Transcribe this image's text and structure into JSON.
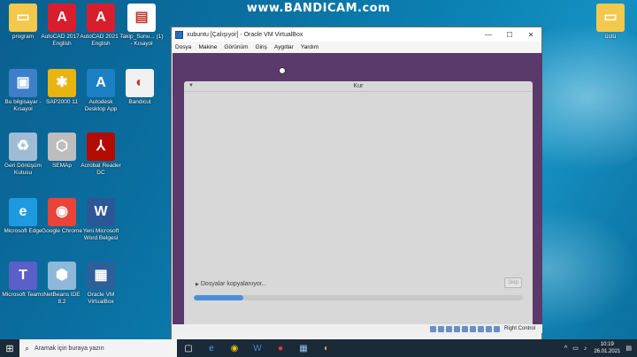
{
  "watermark": "www.BANDICAM.com",
  "desktop_icons": [
    {
      "label": "program",
      "color": "#f2c94c",
      "glyph": "▭"
    },
    {
      "label": "AutoCAD 2017 - English",
      "color": "#d81e2c",
      "glyph": "A"
    },
    {
      "label": "AutoCAD 2021 - English",
      "color": "#d81e2c",
      "glyph": "A"
    },
    {
      "label": "Takip_Sunu... (1) - Kısayol",
      "color": "#ffffff",
      "glyph": "▤"
    },
    {
      "label": "Bu bilgisayar - Kısayol",
      "color": "#3f7fc9",
      "glyph": "▣"
    },
    {
      "label": "SAP2000 11",
      "color": "#e8b40f",
      "glyph": "✱"
    },
    {
      "label": "Autodesk Desktop App",
      "color": "#1b7fc4",
      "glyph": "A"
    },
    {
      "label": "Bandicut",
      "color": "#f1f1f1",
      "glyph": "◐"
    },
    {
      "label": "Geri Dönüşüm Kutusu",
      "color": "#9fbcd4",
      "glyph": "♻"
    },
    {
      "label": "SEMAp",
      "color": "#bdbdbd",
      "glyph": "⬡"
    },
    {
      "label": "Acrobat Reader DC",
      "color": "#b30b00",
      "glyph": "⅄"
    },
    {
      "label": "Microsoft Edge",
      "color": "#1e9be0",
      "glyph": "e"
    },
    {
      "label": "Google Chrome",
      "color": "#e8443a",
      "glyph": "◉"
    },
    {
      "label": "Yeni Microsoft Word Belgesi",
      "color": "#2b5797",
      "glyph": "W"
    },
    {
      "label": "Microsoft Teams",
      "color": "#5b5fc7",
      "glyph": "T"
    },
    {
      "label": "NetBeans IDE 8.2",
      "color": "#8fb8d8",
      "glyph": "⬢"
    },
    {
      "label": "Oracle VM VirtualBox",
      "color": "#2d5f9a",
      "glyph": "▦"
    },
    {
      "label": "üstü",
      "color": "#f2c94c",
      "glyph": "▭"
    }
  ],
  "vbox": {
    "title": "xubuntu [Çalışıyor] - Oracle VM VirtualBox",
    "menu": [
      "Dosya",
      "Makine",
      "Görünüm",
      "Giriş",
      "Aygıtlar",
      "Yardım"
    ],
    "host_key": "Right Control"
  },
  "installer": {
    "title": "Kur",
    "status_text": "Dosyalar kopyalanıyor...",
    "skip_label": "Skip",
    "progress": 0.15
  },
  "taskbar": {
    "search_placeholder": "Aramak için buraya yazın",
    "time": "10:19",
    "date": "26.01.2021"
  }
}
